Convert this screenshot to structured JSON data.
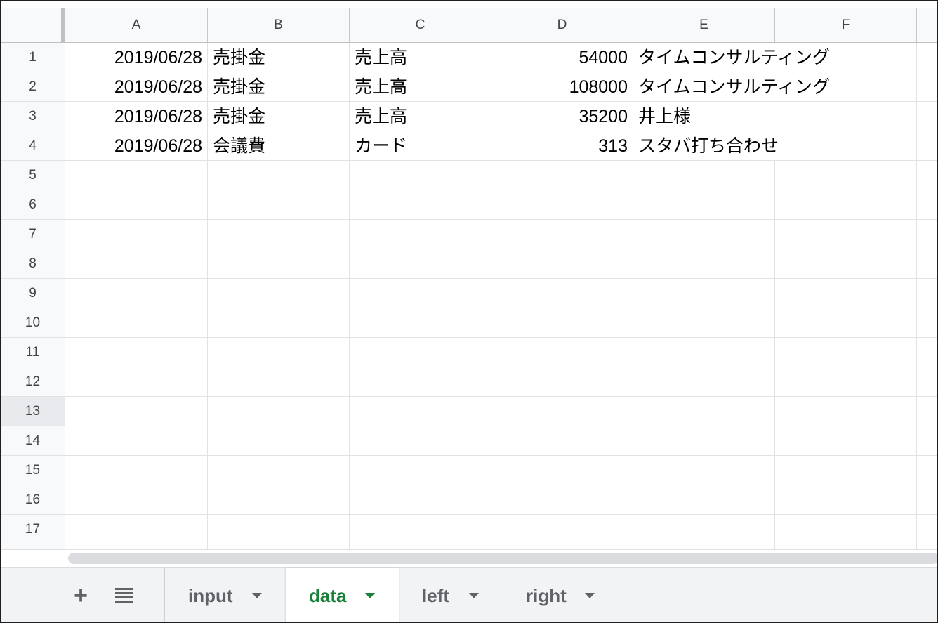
{
  "columns": [
    "A",
    "B",
    "C",
    "D",
    "E",
    "F"
  ],
  "rows": [
    "1",
    "2",
    "3",
    "4",
    "5",
    "6",
    "7",
    "8",
    "9",
    "10",
    "11",
    "12",
    "13",
    "14",
    "15",
    "16",
    "17"
  ],
  "selected_row": "13",
  "cells": [
    {
      "row": "1",
      "date": "2019/06/28",
      "account": "売掛金",
      "category": "売上高",
      "amount": "54000",
      "note": "タイムコンサルティング"
    },
    {
      "row": "2",
      "date": "2019/06/28",
      "account": "売掛金",
      "category": "売上高",
      "amount": "108000",
      "note": "タイムコンサルティング"
    },
    {
      "row": "3",
      "date": "2019/06/28",
      "account": "売掛金",
      "category": "売上高",
      "amount": "35200",
      "note": "井上様"
    },
    {
      "row": "4",
      "date": "2019/06/28",
      "account": "会議費",
      "category": "カード",
      "amount": "313",
      "note": "スタバ打ち合わせ"
    }
  ],
  "toolbar": {
    "add_icon": "plus-icon",
    "all_sheets_icon": "list-icon"
  },
  "tabs": [
    {
      "label": "input",
      "active": false
    },
    {
      "label": "data",
      "active": true
    },
    {
      "label": "left",
      "active": false
    },
    {
      "label": "right",
      "active": false
    }
  ],
  "colors": {
    "active_tab": "#188038",
    "header_bg": "#f8f9fa",
    "selected_row_bg": "#e8eaed"
  }
}
